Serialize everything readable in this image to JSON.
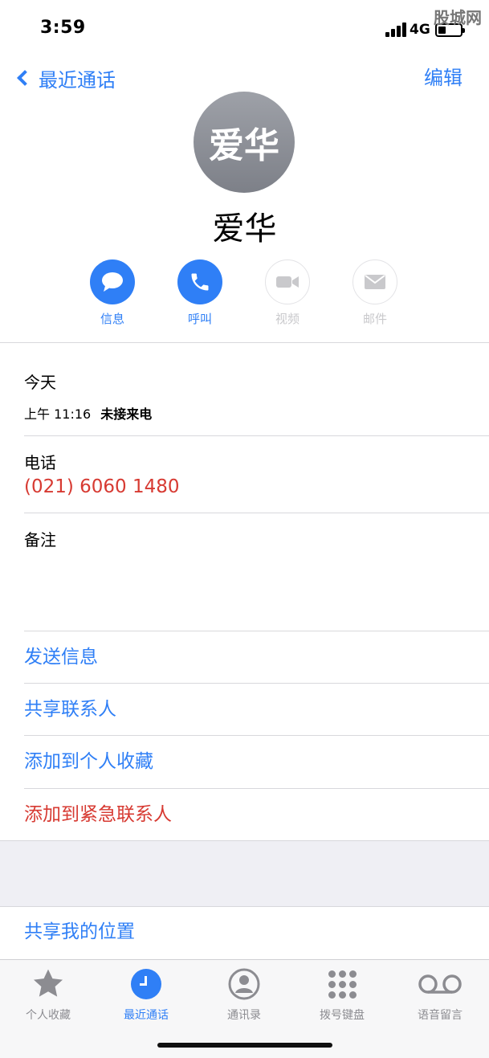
{
  "status_bar": {
    "time": "3:59",
    "network": "4G",
    "watermark": "股城网"
  },
  "nav": {
    "back_label": "最近通话",
    "edit_label": "编辑"
  },
  "contact": {
    "avatar_text": "爱华",
    "name": "爱华"
  },
  "actions": [
    {
      "label": "信息",
      "icon": "message-bubble-icon",
      "enabled": true
    },
    {
      "label": "呼叫",
      "icon": "phone-icon",
      "enabled": true
    },
    {
      "label": "视频",
      "icon": "video-camera-icon",
      "enabled": false
    },
    {
      "label": "邮件",
      "icon": "envelope-icon",
      "enabled": false
    }
  ],
  "recent": {
    "header": "今天",
    "time": "上午 11:16",
    "status": "未接来电"
  },
  "phone": {
    "label": "电话",
    "number": "(021) 6060 1480"
  },
  "notes": {
    "label": "备注"
  },
  "options": [
    {
      "label": "发送信息",
      "color": "#2f7ff6"
    },
    {
      "label": "共享联系人",
      "color": "#2f7ff6"
    },
    {
      "label": "添加到个人收藏",
      "color": "#2f7ff6"
    },
    {
      "label": "添加到紧急联系人",
      "color": "#d73a32"
    }
  ],
  "share_location": "共享我的位置",
  "tabs": [
    {
      "label": "个人收藏",
      "icon": "star-icon",
      "active": false
    },
    {
      "label": "最近通话",
      "icon": "clock-icon",
      "active": true
    },
    {
      "label": "通讯录",
      "icon": "contact-person-icon",
      "active": false
    },
    {
      "label": "拨号键盘",
      "icon": "keypad-icon",
      "active": false
    },
    {
      "label": "语音留言",
      "icon": "voicemail-icon",
      "active": false
    }
  ],
  "colors": {
    "accent": "#2f7ff6",
    "alert": "#d73a32",
    "avatar": "#8e9198",
    "inactive": "#8c8c91"
  }
}
